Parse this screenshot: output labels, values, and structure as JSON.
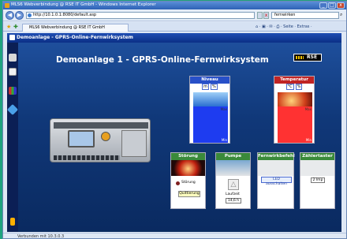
{
  "window": {
    "title": "MLS6 Webverbindung @ RSE IT GmbH - Windows Internet Explorer",
    "minimize": "_",
    "maximize": "□",
    "close": "x"
  },
  "address": {
    "back": "◀",
    "forward": "▶",
    "url": "http://10.1.0.1:8080/default.asp",
    "search_value": "fernwirken"
  },
  "tab": {
    "label": "MLS6 Webverbindung @ RSE IT GmbH"
  },
  "command_bar": {
    "text": "⌂ · ▣ · ✉ · ⎙ · Seite · Extras ·"
  },
  "app": {
    "header": "Demoanlage - GPRS-Online-Fernwirksystem",
    "title": "Demoanlage 1 - GPRS-Online-Fernwirksystem",
    "logo": "RSE"
  },
  "niveau": {
    "title": "Niveau",
    "unit1": "m",
    "unit2": "%",
    "level_fraction": 0.5,
    "top_label": "Max",
    "bottom_label": "Min",
    "colors": {
      "fill": "#1e3cf0",
      "header": "#2850c8"
    }
  },
  "temperatur": {
    "title": "Temperatur",
    "unit1": "°C",
    "unit2": "%",
    "level_fraction": 0.5,
    "top_label": "Max",
    "bottom_label": "Min",
    "colors": {
      "fill": "#ff3232",
      "header": "#c02424"
    }
  },
  "stoerung": {
    "title": "Störung",
    "label": "Störung",
    "button": "Quittierung"
  },
  "pumpe": {
    "title": "Pumpe",
    "label": "Laufzeit",
    "value": "14,6 h"
  },
  "fernwirk": {
    "title": "Fernwirkbefehl",
    "button": "LED ausschalten"
  },
  "zaehler": {
    "title": "Zählertaster",
    "value": "2 Imp"
  },
  "status": {
    "text": "Verbunden mit 10.3.0.3"
  }
}
